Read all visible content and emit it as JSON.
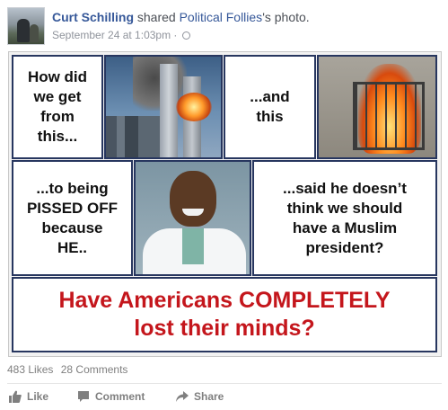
{
  "post": {
    "author": "Curt Schilling",
    "verb": "shared",
    "shared_from": "Political Follies",
    "shared_suffix": "'s photo.",
    "timestamp": "September 24 at 1:03pm",
    "separator": " · "
  },
  "image": {
    "panel1": "How did\nwe get\nfrom\nthis...",
    "panel2": "...and\nthis",
    "panel3": "...to being\nPISSED OFF\nbecause\nHE..",
    "panel4": "...said he doesn’t\nthink we should\nhave a Muslim\npresident?",
    "banner": "Have Americans COMPLETELY\nlost their minds?",
    "colors": {
      "border": "#27365f",
      "banner_text": "#c4161c"
    }
  },
  "stats": {
    "likes": "483 Likes",
    "comments": "28 Comments"
  },
  "actions": {
    "like": "Like",
    "comment": "Comment",
    "share": "Share"
  },
  "icons": {
    "like": "thumbs-up-icon",
    "comment": "speech-bubble-icon",
    "share": "share-arrow-icon",
    "audience": "globe-icon"
  },
  "colors": {
    "link": "#365899",
    "meta": "#90949c",
    "action": "#7f7f7f"
  }
}
